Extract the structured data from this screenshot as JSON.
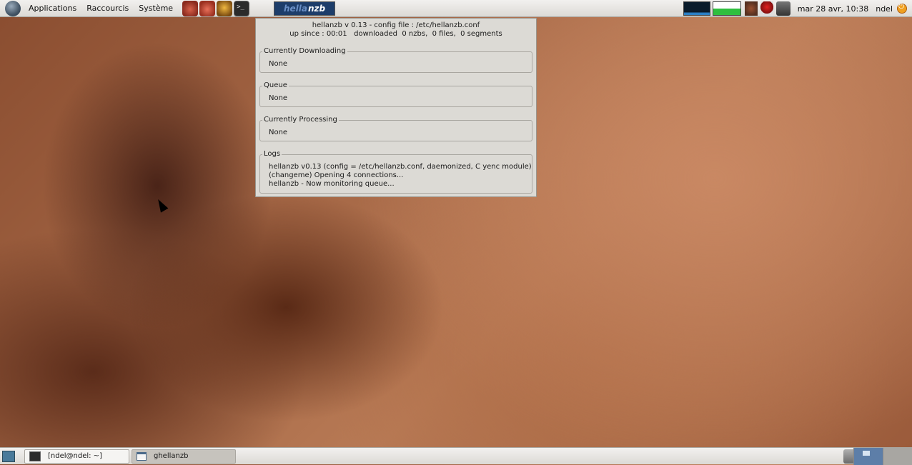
{
  "top_panel": {
    "menus": [
      "Applications",
      "Raccourcis",
      "Système"
    ],
    "launchers": [
      "firefox-icon",
      "thunderbird-icon",
      "burger-icon",
      "terminal-icon"
    ],
    "applet": {
      "prefix": "hella",
      "suffix": "nzb"
    },
    "clock": "mar 28 avr, 10:38",
    "user": "ndel"
  },
  "hellanzb": {
    "header_line1": "hellanzb v 0.13 - config file : /etc/hellanzb.conf",
    "header_line2": "up since : 00:01   downloaded  0 nzbs,  0 files,  0 segments",
    "sections": [
      {
        "label": "Currently Downloading",
        "lines": [
          "None"
        ]
      },
      {
        "label": "Queue",
        "lines": [
          "None"
        ]
      },
      {
        "label": "Currently Processing",
        "lines": [
          "None"
        ]
      },
      {
        "label": "Logs",
        "lines": [
          "hellanzb v0.13 (config = /etc/hellanzb.conf, daemonized, C yenc module)",
          "(changeme) Opening 4 connections...",
          "hellanzb - Now monitoring queue..."
        ]
      }
    ]
  },
  "taskbar": {
    "tasks": [
      {
        "label": "[ndel@ndel: ~]",
        "icon": "terminal-icon"
      },
      {
        "label": "ghellanzb",
        "icon": "window-icon"
      }
    ],
    "workspaces": [
      "1",
      "2"
    ]
  },
  "colors": {
    "panel": "#dcdad5",
    "applet_bg": "#1d3d6a",
    "workspace_active": "#5d7ea8"
  }
}
